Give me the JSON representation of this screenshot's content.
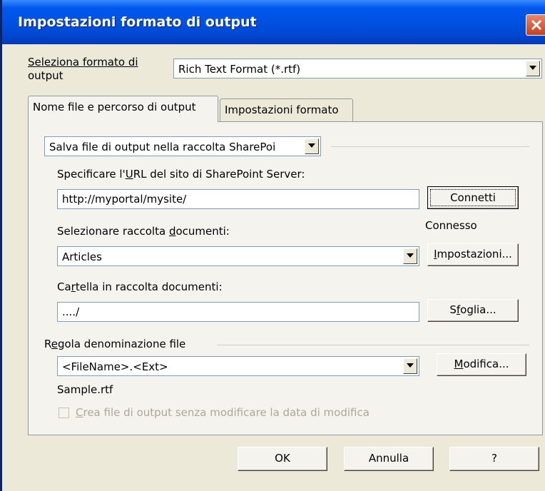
{
  "window": {
    "title": "Impostazioni formato di output"
  },
  "output_format": {
    "label_line1": "Seleziona formato di",
    "label_line2": "output",
    "value": "Rich Text Format (*.rtf)"
  },
  "tabs": [
    {
      "label": "Nome file e percorso di output"
    },
    {
      "label": "Impostazioni formato"
    }
  ],
  "location": {
    "value": "Salva file di output nella raccolta SharePoi"
  },
  "sharepoint": {
    "url_label_pre": "Specificare l'",
    "url_label_u": "U",
    "url_label_post": "RL del sito di SharePoint Server:",
    "url_value": "http://myportal/mysite/",
    "connect_button": "Connetti",
    "status": "Connesso"
  },
  "library": {
    "label_pre": "Selezionare raccolta ",
    "label_u": "d",
    "label_post": "ocumenti:",
    "value": "Articles",
    "settings_button_u": "I",
    "settings_button_post": "mpostazioni..."
  },
  "folder": {
    "label_pre": "Ca",
    "label_u": "r",
    "label_post": "tella in raccolta documenti:",
    "value": "..../",
    "browse_button_pre": "S",
    "browse_button_u": "f",
    "browse_button_post": "oglia..."
  },
  "naming": {
    "label_pre": "R",
    "label_u": "e",
    "label_post": "gola denominazione file",
    "value": "<FileName>.<Ext>",
    "modify_button_u": "M",
    "modify_button_post": "odifica...",
    "sample": "Sample.rtf"
  },
  "preserve_date": {
    "label_u": "C",
    "label_post": "rea file di output senza modificare la data di modifica",
    "checked": false
  },
  "buttons": {
    "ok": "OK",
    "cancel": "Annulla",
    "help": "?"
  }
}
